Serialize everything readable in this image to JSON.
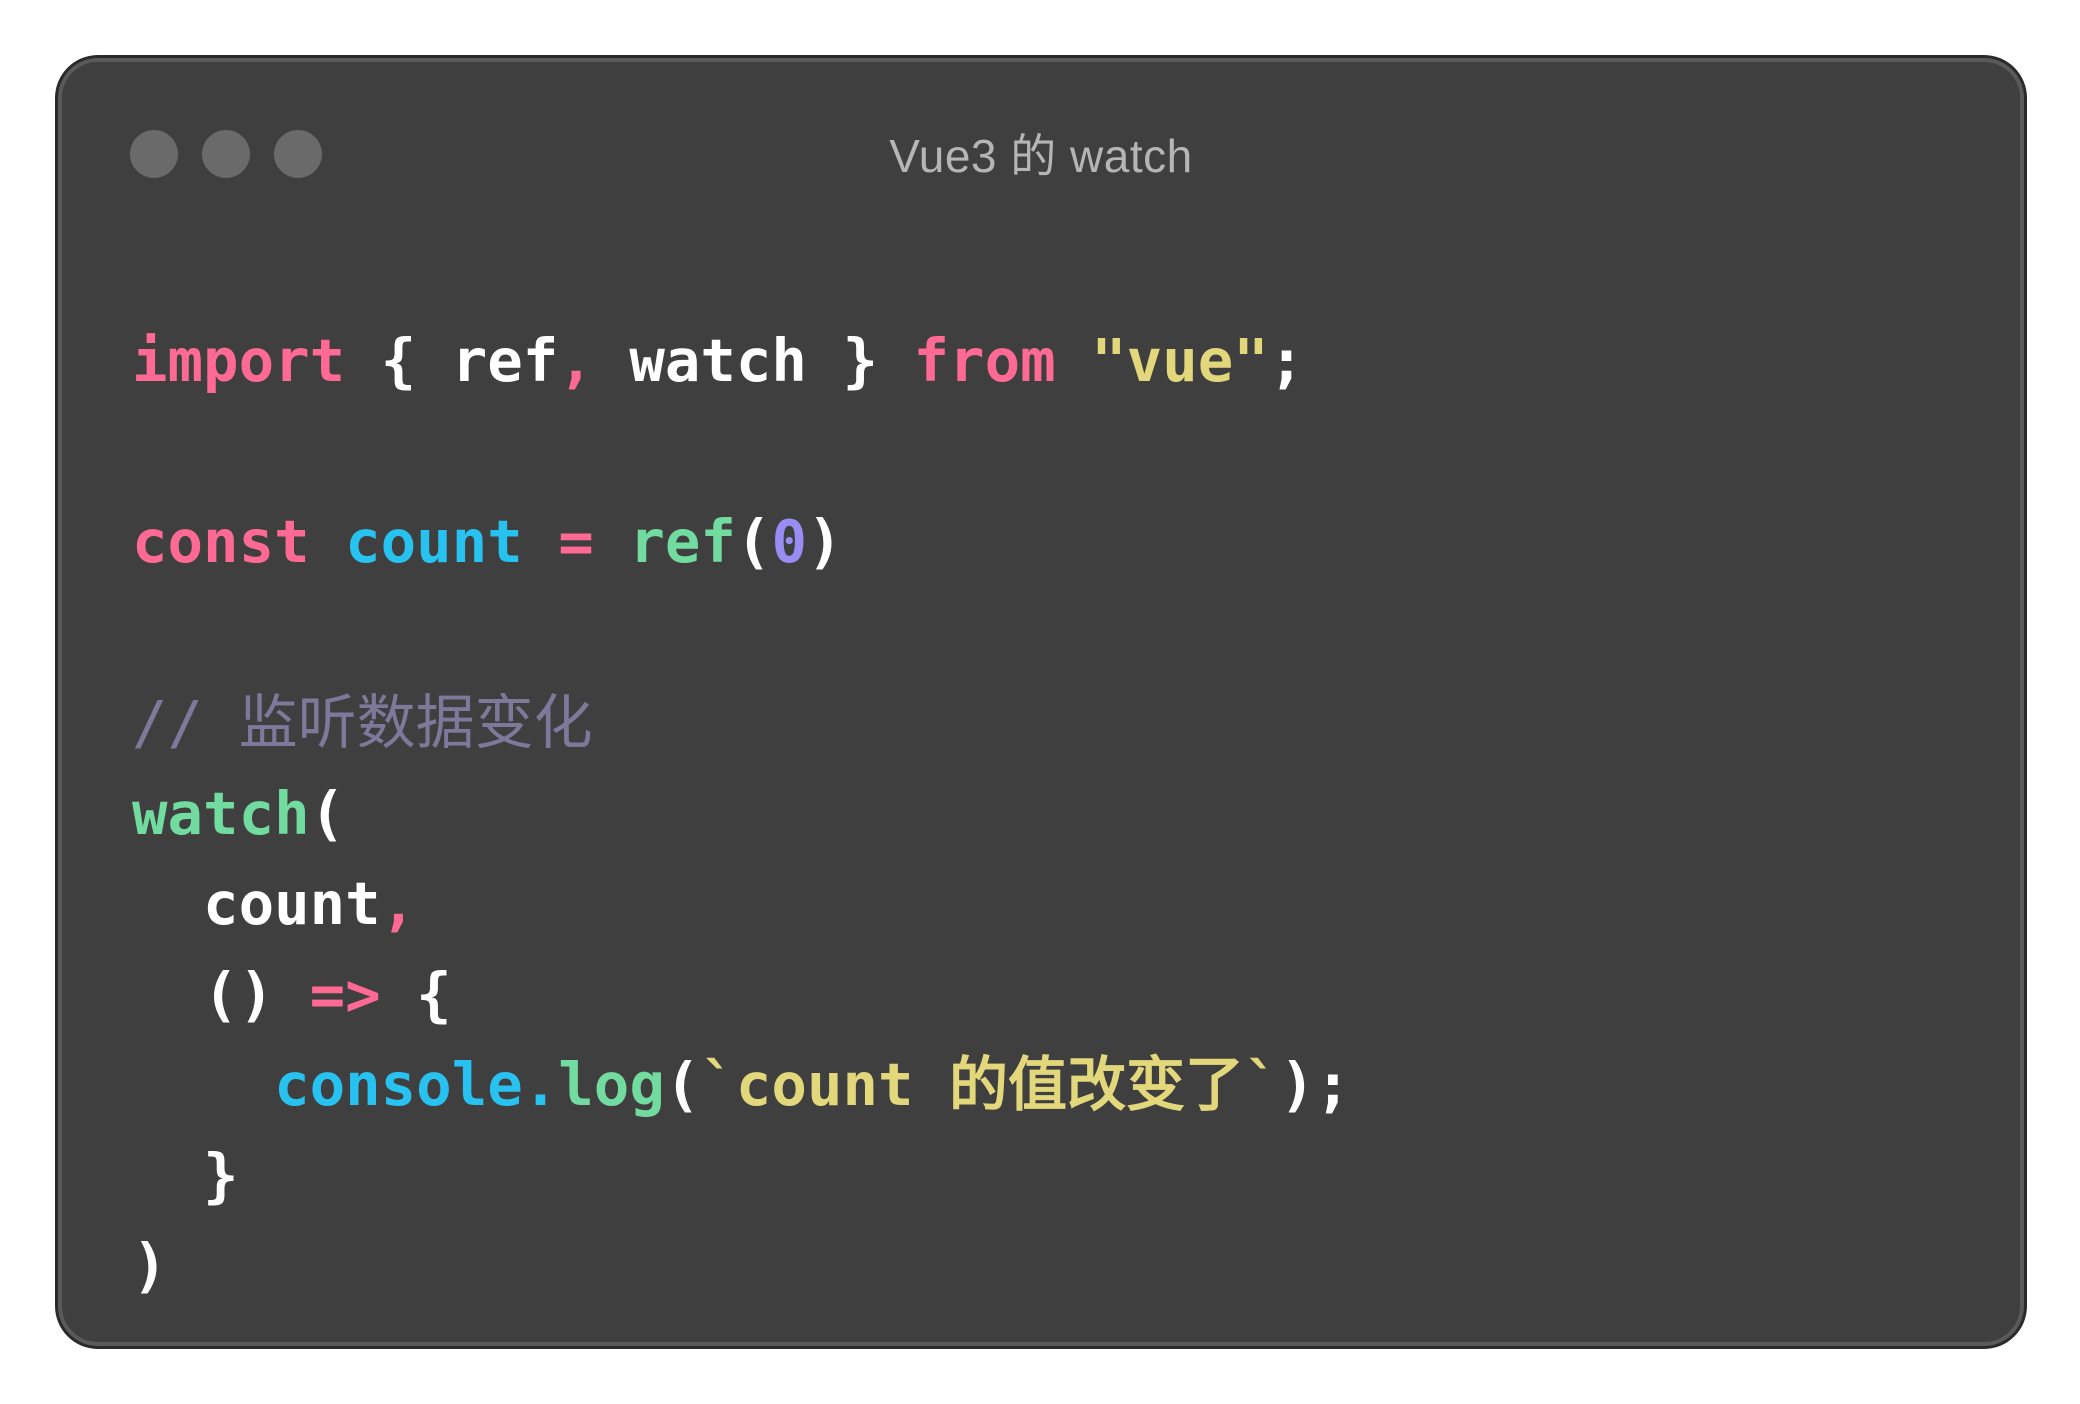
{
  "window": {
    "title": "Vue3 的 watch",
    "controls": [
      "close-dot",
      "minimize-dot",
      "maximize-dot"
    ]
  },
  "code": {
    "language": "javascript",
    "lines": [
      [
        {
          "t": "import",
          "k": "keyword"
        },
        {
          "t": " { ",
          "k": "plain"
        },
        {
          "t": "ref",
          "k": "plain"
        },
        {
          "t": ",",
          "k": "punct"
        },
        {
          "t": " watch } ",
          "k": "plain"
        },
        {
          "t": "from",
          "k": "keyword"
        },
        {
          "t": " ",
          "k": "plain"
        },
        {
          "t": "\"vue\"",
          "k": "string"
        },
        {
          "t": ";",
          "k": "plain"
        }
      ],
      [],
      [
        {
          "t": "const",
          "k": "keyword"
        },
        {
          "t": " ",
          "k": "plain"
        },
        {
          "t": "count",
          "k": "var"
        },
        {
          "t": " ",
          "k": "plain"
        },
        {
          "t": "=",
          "k": "punct"
        },
        {
          "t": " ",
          "k": "plain"
        },
        {
          "t": "ref",
          "k": "func"
        },
        {
          "t": "(",
          "k": "plain"
        },
        {
          "t": "0",
          "k": "number"
        },
        {
          "t": ")",
          "k": "plain"
        }
      ],
      [],
      [
        {
          "t": "// 监听数据变化",
          "k": "comment"
        }
      ],
      [
        {
          "t": "watch",
          "k": "func"
        },
        {
          "t": "(",
          "k": "plain"
        }
      ],
      [
        {
          "t": "  count",
          "k": "plain"
        },
        {
          "t": ",",
          "k": "punct"
        }
      ],
      [
        {
          "t": "  () ",
          "k": "plain"
        },
        {
          "t": "=>",
          "k": "punct"
        },
        {
          "t": " {",
          "k": "plain"
        }
      ],
      [
        {
          "t": "    ",
          "k": "plain"
        },
        {
          "t": "console",
          "k": "obj"
        },
        {
          "t": ".",
          "k": "obj"
        },
        {
          "t": "log",
          "k": "func"
        },
        {
          "t": "(",
          "k": "plain"
        },
        {
          "t": "`count 的值改变了`",
          "k": "string"
        },
        {
          "t": ");",
          "k": "plain"
        }
      ],
      [
        {
          "t": "  }",
          "k": "plain"
        }
      ],
      [
        {
          "t": ")",
          "k": "plain"
        }
      ]
    ]
  }
}
